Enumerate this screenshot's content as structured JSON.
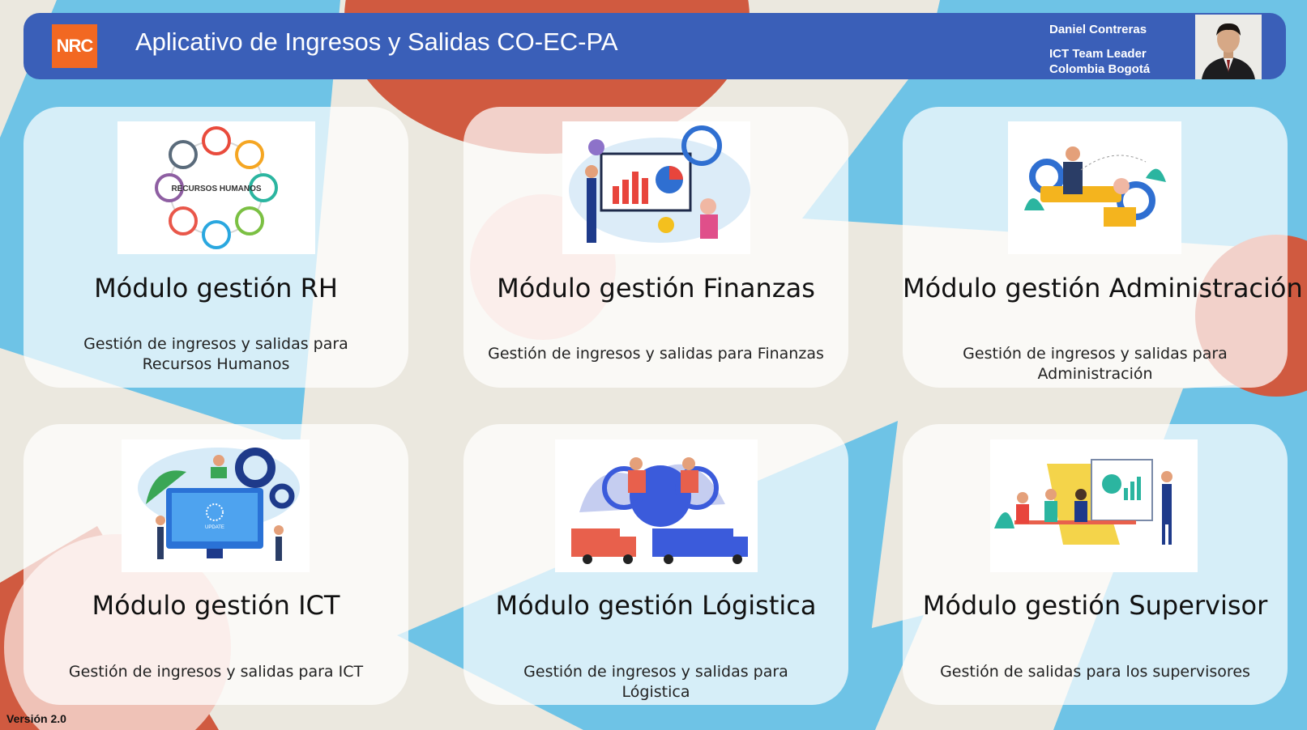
{
  "header": {
    "logo_text": "NRC",
    "title": "Aplicativo de Ingresos y Salidas CO-EC-PA",
    "user": {
      "name": "Daniel Contreras",
      "role": "ICT Team Leader",
      "location": "Colombia Bogotá"
    }
  },
  "modules": [
    {
      "title": "Módulo gestión RH",
      "description": "Gestión de ingresos y salidas para Recursos Humanos",
      "image_label": "RECURSOS HUMANOS"
    },
    {
      "title": "Módulo gestión Finanzas",
      "description": "Gestión de ingresos y salidas para Finanzas"
    },
    {
      "title": "Módulo gestión Administración",
      "description": "Gestión de ingresos y salidas para Administración"
    },
    {
      "title": "Módulo gestión ICT",
      "description": "Gestión de ingresos y salidas para ICT",
      "image_label": "UPDATE"
    },
    {
      "title": "Módulo gestión Lógistica",
      "description": "Gestión de ingresos y salidas para Lógistica"
    },
    {
      "title": "Módulo gestión Supervisor",
      "description": "Gestión de salidas para los supervisores"
    }
  ],
  "footer": {
    "version": "Versión 2.0"
  },
  "colors": {
    "background": "#ebe8df",
    "header": "#3a5fb8",
    "logo": "#f26822",
    "shape_blue": "#6ec3e6",
    "shape_red": "#d05a40",
    "shape_pink": "#efc2b7"
  }
}
